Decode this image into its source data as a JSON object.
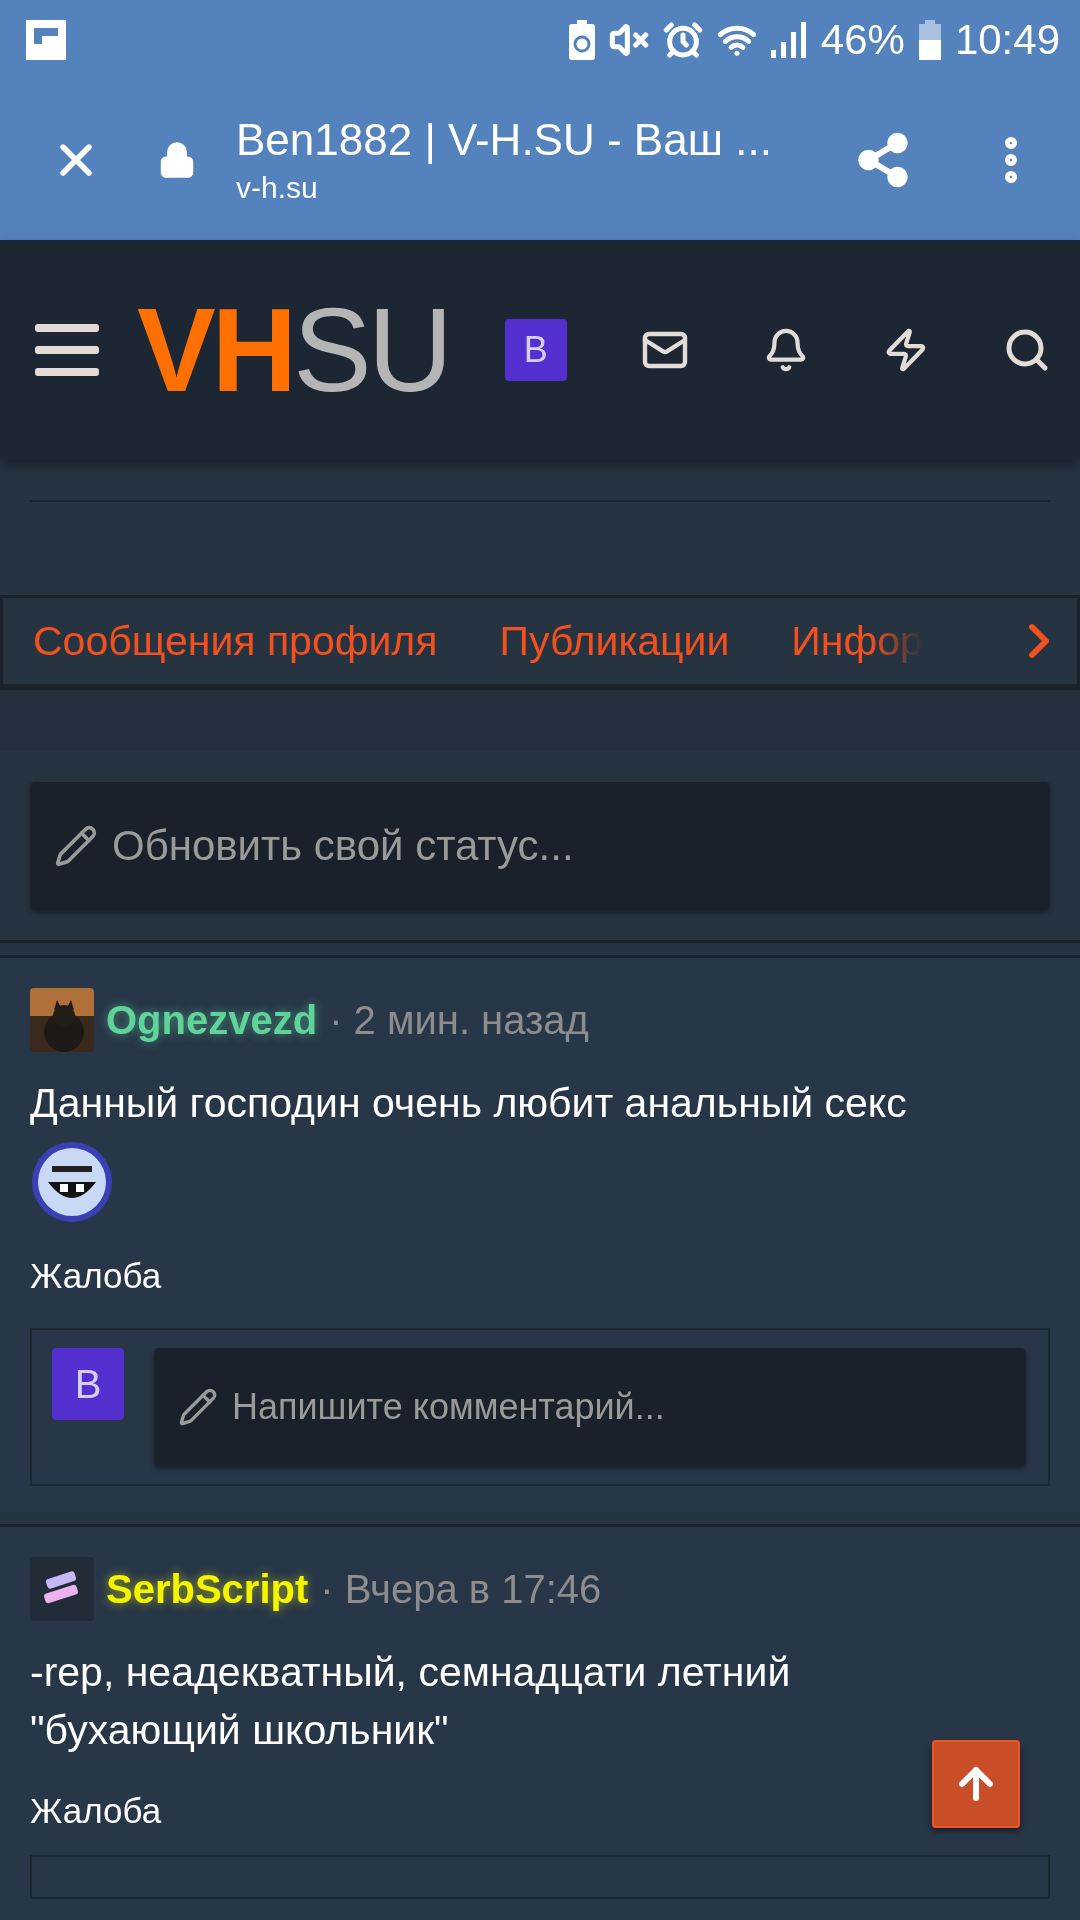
{
  "status_bar": {
    "battery_percent": "46%",
    "time": "10:49"
  },
  "browser": {
    "title": "Ben1882 | V-H.SU - Ваш ...",
    "url": "v-h.su"
  },
  "header": {
    "logo": {
      "accent": "VH",
      "rest": "SU"
    },
    "avatar": "B"
  },
  "tabs": [
    {
      "label": "Сообщения профиля",
      "faded": false
    },
    {
      "label": "Публикации",
      "faded": false
    },
    {
      "label": "Инфор",
      "faded": true
    }
  ],
  "status_field": {
    "placeholder": "Обновить свой статус..."
  },
  "posts": [
    {
      "author": "Ognezvezd",
      "color": "#5fd39a",
      "time": "· 2 мин. назад",
      "text": "Данный господин очень любит анальный секс",
      "smiley": true,
      "report": "Жалоба",
      "comment": {
        "avatar": "B",
        "placeholder": "Напишите комментарий..."
      }
    },
    {
      "author": "SerbScript",
      "color": "#f5f500",
      "time": "· Вчера в 17:46",
      "text": "-rep, неадекватный, семнадцати летний \"бухающий школьник\"",
      "smiley": false,
      "report": "Жалоба",
      "comment_box": true
    }
  ]
}
